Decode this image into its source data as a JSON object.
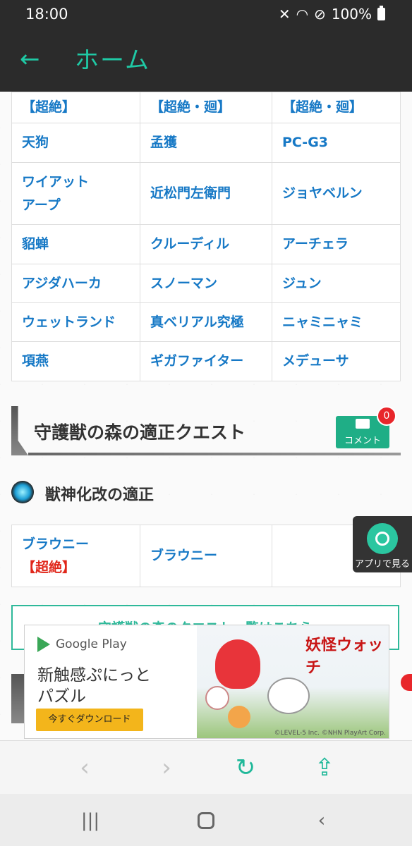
{
  "status_bar": {
    "time": "18:00",
    "battery": "100%",
    "icons": [
      "mute-icon",
      "wifi-icon",
      "no-disturb-icon",
      "battery-icon"
    ]
  },
  "header": {
    "title": "ホーム",
    "back_icon": "arrow-left-icon"
  },
  "table1": {
    "rows": [
      [
        "【超絶】",
        "【超絶・廻】",
        "【超絶・廻】"
      ],
      [
        "天狗",
        "孟獲",
        "PC-G3"
      ],
      [
        "ワイアット\nアープ",
        "近松門左衛門",
        "ジョヤベルン"
      ],
      [
        "貂蝉",
        "クルーディル",
        "アーチェラ"
      ],
      [
        "アジダハーカ",
        "スノーマン",
        "ジュン"
      ],
      [
        "ウェットランド",
        "真ベリアル究極",
        "ニャミニャミ"
      ],
      [
        "項燕",
        "ギガファイター",
        "メデューサ"
      ]
    ]
  },
  "section": {
    "title": "守護獣の森の適正クエスト",
    "comment_label": "コメント",
    "comment_count": "0"
  },
  "subsection": {
    "title": "獣神化改の適正"
  },
  "table2": {
    "cell1_line1": "ブラウニー",
    "cell1_line2": "【超絶】",
    "cell2": "ブラウニー",
    "cell3": ""
  },
  "app_button": {
    "label": "アプリで見る"
  },
  "link_box": {
    "text": "守護獣の森のクエスト一覧はこちら"
  },
  "ad": {
    "store": "Google Play",
    "copy": "新触感ぷにっと\nパズル",
    "cta": "今すぐダウンロード",
    "logo_text": "妖怪ウォッチ",
    "credit": "©LEVEL-5 Inc. ©NHN PlayArt Corp."
  },
  "toolbar": {
    "buttons": [
      {
        "name": "back",
        "glyph": "‹"
      },
      {
        "name": "forward",
        "glyph": "›"
      },
      {
        "name": "reload",
        "glyph": "↻"
      },
      {
        "name": "share",
        "glyph": "⇪"
      }
    ]
  },
  "colors": {
    "accent": "#1fc9a5",
    "link": "#1779c6",
    "red": "#e0261a",
    "header_bg": "#2b2b2b"
  }
}
